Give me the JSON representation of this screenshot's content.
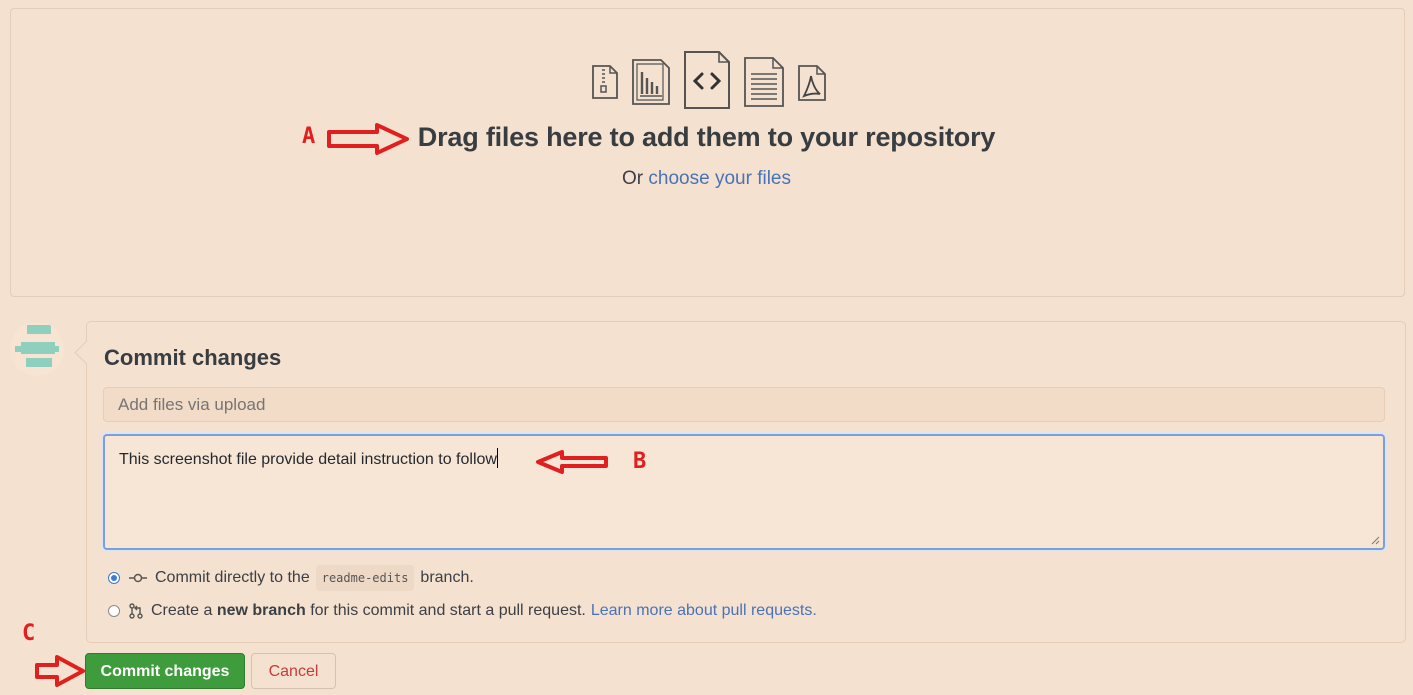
{
  "upload": {
    "icons": [
      "zip-file-icon",
      "chart-file-icon",
      "code-file-icon",
      "text-file-icon",
      "pdf-file-icon"
    ],
    "title": "Drag files here to add them to your repository",
    "choose_prefix": "Or",
    "choose_link": "choose your files"
  },
  "annotations": {
    "a": "A",
    "b": "B",
    "c": "C",
    "color": "#e0201f"
  },
  "commit": {
    "title": "Commit changes",
    "summary_placeholder": "Add files via upload",
    "description_value": "This screenshot file provide detail instruction to follow",
    "option_direct": {
      "prefix": "Commit directly to the",
      "branch": "readme-edits",
      "suffix": "branch.",
      "checked": true
    },
    "option_new_branch": {
      "prefix": "Create a",
      "bold": "new branch",
      "suffix": "for this commit and start a pull request.",
      "link": "Learn more about pull requests.",
      "checked": false
    },
    "submit_label": "Commit changes",
    "cancel_label": "Cancel"
  },
  "colors": {
    "background": "#f5e1cf",
    "primary_button": "#3f9c3c",
    "link": "#4873b8",
    "cancel_text": "#c43c3c"
  }
}
